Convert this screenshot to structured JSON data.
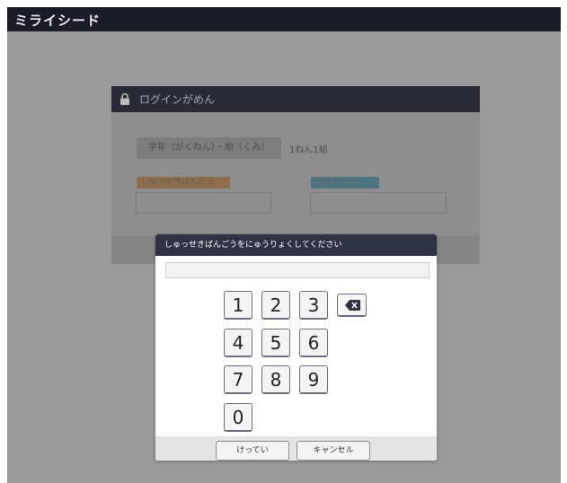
{
  "app": {
    "logo": "ミライシード"
  },
  "login": {
    "title": "ログインがめん",
    "class_button_label": "学年（がくねん）・組（くみ）",
    "class_value": "1ねん1組",
    "student_number_label": "しゅっせきばんごう",
    "password_label": "パスワード"
  },
  "keypad": {
    "prompt": "しゅっせきばんごうをにゅうりょくしてください",
    "input_value": "",
    "keys": [
      "1",
      "2",
      "3",
      "4",
      "5",
      "6",
      "7",
      "8",
      "9",
      "0"
    ],
    "confirm_label": "けってい",
    "cancel_label": "キャンセル"
  }
}
